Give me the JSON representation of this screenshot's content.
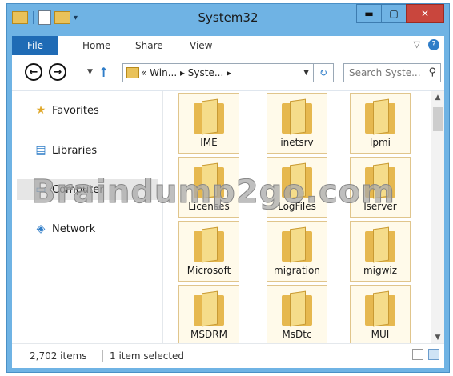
{
  "window": {
    "title": "System32"
  },
  "ribbon": {
    "tabs": [
      "File",
      "Home",
      "Share",
      "View"
    ]
  },
  "address": {
    "crumbs": "«  Win...  ▸  Syste...  ▸"
  },
  "search": {
    "placeholder": "Search Syste..."
  },
  "nav": {
    "items": [
      "Favorites",
      "Libraries",
      "Computer",
      "Network"
    ]
  },
  "folders": [
    "IME",
    "inetsrv",
    "lpmi",
    "Licenses",
    "LogFiles",
    "lserver",
    "Microsoft",
    "migration",
    "migwiz",
    "MSDRM",
    "MsDtc",
    "MUI"
  ],
  "status": {
    "items": "2,702 items",
    "selected": "1 item selected"
  },
  "watermark": "Braindump2go.com",
  "colors": {
    "accent": "#1f6bb5",
    "titlebar": "#6fb3e4",
    "close": "#c9463d",
    "folder": "#e6b84f"
  },
  "icons": [
    "folder-icon",
    "star-icon",
    "library-icon",
    "computer-icon",
    "network-icon",
    "back-icon",
    "forward-icon",
    "up-icon",
    "refresh-icon",
    "search-icon"
  ]
}
